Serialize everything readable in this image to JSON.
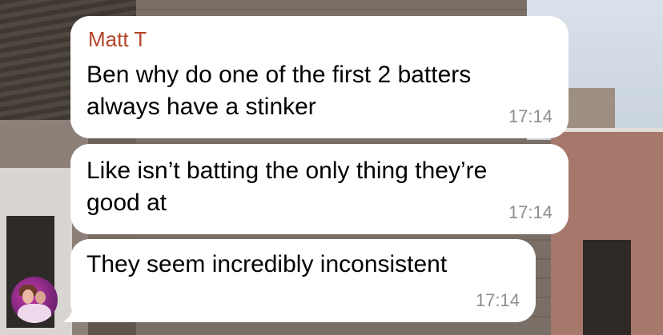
{
  "chat": {
    "messages": [
      {
        "sender": "Matt T",
        "text": "Ben why do one of the first 2 batters\nalways have a stinker",
        "time": "17:14"
      },
      {
        "text": "Like isn’t batting the only thing they’re\ngood at",
        "time": "17:14"
      },
      {
        "text": "They seem incredibly inconsistent",
        "time": "17:14"
      }
    ]
  },
  "colors": {
    "sender_name": "#b5452a",
    "bubble": "#ffffff",
    "timestamp": "#8e8e93"
  }
}
